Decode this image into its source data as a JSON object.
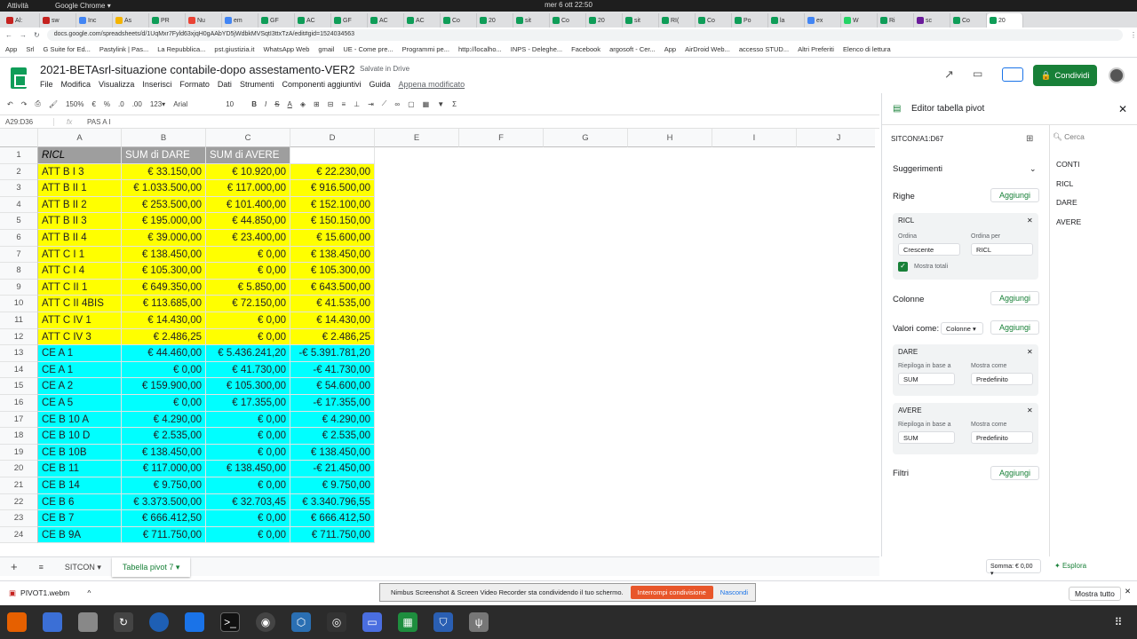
{
  "system": {
    "activities": "Attività",
    "app": "Google Chrome ▾",
    "clock": "mer 6 ott  22:50"
  },
  "tabs": [
    {
      "label": "Al:",
      "color": "#c5221f"
    },
    {
      "label": "sw",
      "color": "#c5221f"
    },
    {
      "label": "Inc",
      "color": "#4285f4"
    },
    {
      "label": "As",
      "color": "#f4b400"
    },
    {
      "label": "PR",
      "color": "#0f9d58"
    },
    {
      "label": "Nu",
      "color": "#ea4335"
    },
    {
      "label": "em",
      "color": "#4285f4"
    },
    {
      "label": "GF",
      "color": "#0f9d58"
    },
    {
      "label": "AC",
      "color": "#0f9d58"
    },
    {
      "label": "GF",
      "color": "#0f9d58"
    },
    {
      "label": "AC",
      "color": "#0f9d58"
    },
    {
      "label": "AC",
      "color": "#0f9d58"
    },
    {
      "label": "Co",
      "color": "#0f9d58"
    },
    {
      "label": "20",
      "color": "#0f9d58"
    },
    {
      "label": "sit",
      "color": "#0f9d58"
    },
    {
      "label": "Co",
      "color": "#0f9d58"
    },
    {
      "label": "20",
      "color": "#0f9d58"
    },
    {
      "label": "sit",
      "color": "#0f9d58"
    },
    {
      "label": "RI(",
      "color": "#0f9d58"
    },
    {
      "label": "Co",
      "color": "#0f9d58"
    },
    {
      "label": "Po",
      "color": "#0f9d58"
    },
    {
      "label": "la",
      "color": "#0f9d58"
    },
    {
      "label": "ex",
      "color": "#4285f4"
    },
    {
      "label": "W",
      "color": "#25d366"
    },
    {
      "label": "Ri",
      "color": "#0f9d58"
    },
    {
      "label": "sc",
      "color": "#6a1b9a"
    },
    {
      "label": "Co",
      "color": "#0f9d58"
    },
    {
      "label": "20",
      "color": "#0f9d58"
    }
  ],
  "address": {
    "url": "docs.google.com/spreadsheets/d/1UqMxr7Fyld63xjqH0gAAbYD5jWdbkMVSqtI3ttxTzA/edit#gid=1524034563"
  },
  "bookmarks": [
    "App",
    "Srl",
    "G Suite for Ed...",
    "Pastylink | Pas...",
    "La Repubblica...",
    "pst.giustizia.it",
    "WhatsApp Web",
    "gmail",
    "UE - Come pre...",
    "Programmi pe...",
    "http://localho...",
    "INPS - Deleghe...",
    "Facebook",
    "argosoft - Cer...",
    "App",
    "AirDroid Web...",
    "accesso STUD...",
    "Altri Preferiti",
    "Elenco di lettura"
  ],
  "doc": {
    "title": "2021-BETAsrl-situazione contabile-dopo assestamento-VER2",
    "saved": "Salvate in Drive",
    "share": "Condividi"
  },
  "menus": [
    "File",
    "Modifica",
    "Visualizza",
    "Inserisci",
    "Formato",
    "Dati",
    "Strumenti",
    "Componenti aggiuntivi",
    "Guida"
  ],
  "menu_last": "Appena modificato",
  "toolbar": {
    "zoom": "150%",
    "currency": "€",
    "percent": "%",
    "dec1": ".0",
    "dec2": ".00",
    "fmt": "123▾",
    "font": "Arial",
    "size": "10"
  },
  "formula": {
    "ref": "A29:D36",
    "fx": "fx",
    "content": "PAS A I"
  },
  "columns": [
    "A",
    "B",
    "C",
    "D",
    "E",
    "F",
    "G",
    "H",
    "I",
    "J"
  ],
  "header_row": [
    "RICL",
    "SUM di DARE",
    "SUM di AVERE",
    ""
  ],
  "rows": [
    [
      "ATT B I 3",
      "€ 33.150,00",
      "€ 10.920,00",
      "€ 22.230,00"
    ],
    [
      "ATT B II 1",
      "€ 1.033.500,00",
      "€ 117.000,00",
      "€ 916.500,00"
    ],
    [
      "ATT B II 2",
      "€ 253.500,00",
      "€ 101.400,00",
      "€ 152.100,00"
    ],
    [
      "ATT B II 3",
      "€ 195.000,00",
      "€ 44.850,00",
      "€ 150.150,00"
    ],
    [
      "ATT B II 4",
      "€ 39.000,00",
      "€ 23.400,00",
      "€ 15.600,00"
    ],
    [
      "ATT C I 1",
      "€ 138.450,00",
      "€ 0,00",
      "€ 138.450,00"
    ],
    [
      "ATT C I 4",
      "€ 105.300,00",
      "€ 0,00",
      "€ 105.300,00"
    ],
    [
      "ATT C II 1",
      "€ 649.350,00",
      "€ 5.850,00",
      "€ 643.500,00"
    ],
    [
      "ATT C II 4BIS",
      "€ 113.685,00",
      "€ 72.150,00",
      "€ 41.535,00"
    ],
    [
      "ATT C IV 1",
      "€ 14.430,00",
      "€ 0,00",
      "€ 14.430,00"
    ],
    [
      "ATT C IV 3",
      "€ 2.486,25",
      "€ 0,00",
      "€ 2.486,25"
    ],
    [
      "CE A 1",
      "€ 44.460,00",
      "€ 5.436.241,20",
      "-€ 5.391.781,20"
    ],
    [
      "CE A 1",
      "€ 0,00",
      "€ 41.730,00",
      "-€ 41.730,00"
    ],
    [
      "CE A 2",
      "€ 159.900,00",
      "€ 105.300,00",
      "€ 54.600,00"
    ],
    [
      "CE A 5",
      "€ 0,00",
      "€ 17.355,00",
      "-€ 17.355,00"
    ],
    [
      "CE B 10 A",
      "€ 4.290,00",
      "€ 0,00",
      "€ 4.290,00"
    ],
    [
      "CE B 10 D",
      "€ 2.535,00",
      "€ 0,00",
      "€ 2.535,00"
    ],
    [
      "CE B 10B",
      "€ 138.450,00",
      "€ 0,00",
      "€ 138.450,00"
    ],
    [
      "CE B 11",
      "€ 117.000,00",
      "€ 138.450,00",
      "-€ 21.450,00"
    ],
    [
      "CE B 14",
      "€ 9.750,00",
      "€ 0,00",
      "€ 9.750,00"
    ],
    [
      "CE B 6",
      "€ 3.373.500,00",
      "€ 32.703,45",
      "€ 3.340.796,55"
    ],
    [
      "CE B 7",
      "€ 666.412,50",
      "€ 0,00",
      "€ 666.412,50"
    ],
    [
      "CE B 9A",
      "€ 711.750,00",
      "€ 0,00",
      "€ 711.750,00"
    ]
  ],
  "colors": {
    "att": "#ffff00",
    "ce": "#00ffff",
    "header": "#9e9e9e",
    "green": "#188038"
  },
  "sheets": {
    "add": "+",
    "list": "≡",
    "tab1": "SITCON ▾",
    "tab2": "Tabella pivot 7 ▾",
    "sum": "Somma: € 0,00 ▾",
    "explore": "Esplora"
  },
  "pivot": {
    "title": "Editor tabella pivot",
    "range": "SITCON!A1:D67",
    "search": "Cerca",
    "fields": [
      "CONTI",
      "RICL",
      "DARE",
      "AVERE"
    ],
    "suggestions": "Suggerimenti",
    "rows_label": "Righe",
    "columns_label": "Colonne",
    "values_label": "Valori come:",
    "values_select": "Colonne ▾",
    "filters_label": "Filtri",
    "add": "Aggiungi",
    "row_field": {
      "name": "RICL",
      "order_label": "Ordina",
      "order": "Crescente",
      "orderby_label": "Ordina per",
      "orderby": "RICL",
      "totals": "Mostra totali"
    },
    "values": [
      {
        "name": "DARE",
        "summ_label": "Riepiloga in base a",
        "summ": "SUM",
        "show_label": "Mostra come",
        "show": "Predefinito"
      },
      {
        "name": "AVERE",
        "summ_label": "Riepiloga in base a",
        "summ": "SUM",
        "show_label": "Mostra come",
        "show": "Predefinito"
      }
    ]
  },
  "downloads": {
    "file": "PIVOT1.webm",
    "notice": "Nimbus Screenshot & Screen Video Recorder sta condividendo il tuo schermo.",
    "stop": "Interrompi condivisione",
    "hide": "Nascondi",
    "show_all": "Mostra tutto"
  }
}
